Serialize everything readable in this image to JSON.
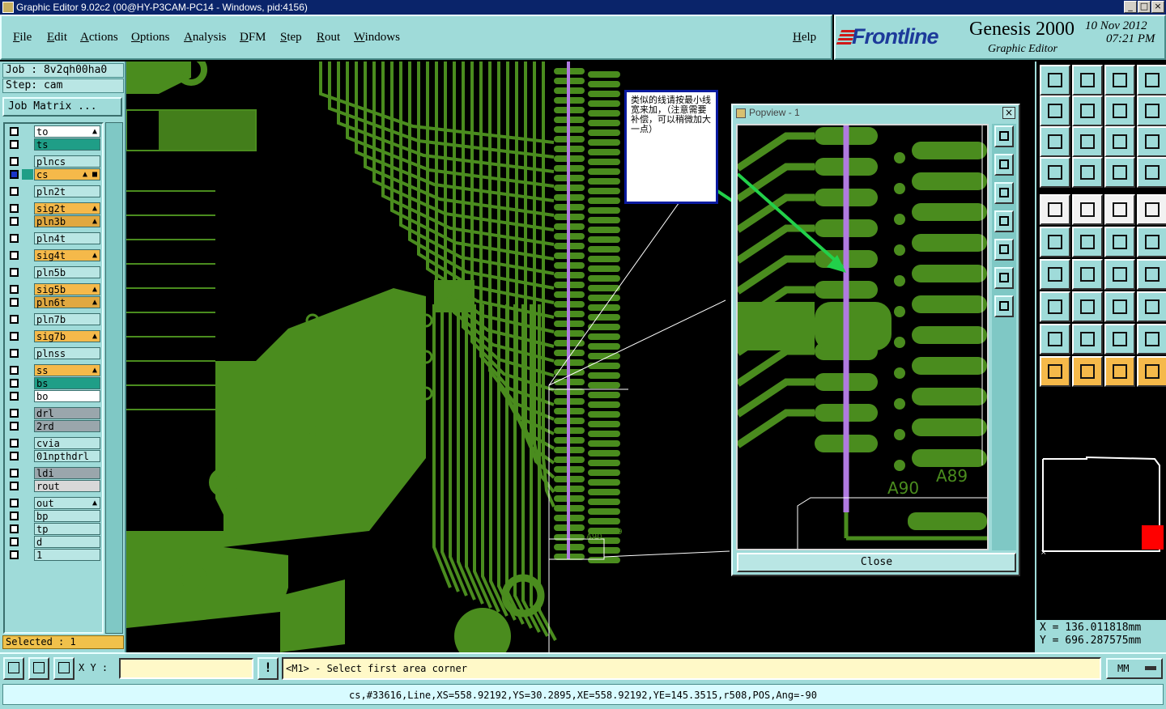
{
  "window": {
    "title": "Graphic Editor 9.02c2 (00@HY-P3CAM-PC14 - Windows, pid:4156)"
  },
  "menu": [
    "File",
    "Edit",
    "Actions",
    "Options",
    "Analysis",
    "DFM",
    "Step",
    "Rout",
    "Windows"
  ],
  "help": "Help",
  "brand": {
    "logo": "Frontline",
    "product": "Genesis 2000",
    "subtitle": "Graphic Editor",
    "date": "10 Nov 2012",
    "time": "07:21 PM"
  },
  "job": {
    "job_line": "Job : 8v2qh00ha0",
    "step_line": "Step: cam",
    "matrix_button": "Job Matrix ..."
  },
  "layers": [
    {
      "name": "to",
      "color": "#ffffff",
      "mark": "▲"
    },
    {
      "name": "ts",
      "color": "#1f9e87",
      "mark": ""
    },
    {
      "name": "plncs",
      "color": "#b9e6e4",
      "mark": ""
    },
    {
      "name": "cs",
      "color": "#f5b94a",
      "mark": "▲ ■",
      "active": true
    },
    {
      "name": "pln2t",
      "color": "#b9e6e4",
      "mark": ""
    },
    {
      "name": "sig2t",
      "color": "#f5b94a",
      "mark": "▲"
    },
    {
      "name": "pln3b",
      "color": "#e0a840",
      "mark": "▲"
    },
    {
      "name": "pln4t",
      "color": "#b9e6e4",
      "mark": ""
    },
    {
      "name": "sig4t",
      "color": "#f5b94a",
      "mark": "▲"
    },
    {
      "name": "pln5b",
      "color": "#b9e6e4",
      "mark": ""
    },
    {
      "name": "sig5b",
      "color": "#f5b94a",
      "mark": "▲"
    },
    {
      "name": "pln6t",
      "color": "#e0a840",
      "mark": "▲"
    },
    {
      "name": "pln7b",
      "color": "#b9e6e4",
      "mark": ""
    },
    {
      "name": "sig7b",
      "color": "#f5b94a",
      "mark": "▲"
    },
    {
      "name": "plnss",
      "color": "#b9e6e4",
      "mark": ""
    },
    {
      "name": "ss",
      "color": "#f5b94a",
      "mark": "▲"
    },
    {
      "name": "bs",
      "color": "#1f9e87",
      "mark": ""
    },
    {
      "name": "bo",
      "color": "#ffffff",
      "mark": ""
    },
    {
      "name": "drl",
      "color": "#9aa6ac",
      "mark": ""
    },
    {
      "name": "2rd",
      "color": "#9aa6ac",
      "mark": ""
    },
    {
      "name": "cvia",
      "color": "#b9e6e4",
      "mark": ""
    },
    {
      "name": "01npthdrl",
      "color": "#b9e6e4",
      "mark": ""
    },
    {
      "name": "ldi",
      "color": "#9aa6ac",
      "mark": ""
    },
    {
      "name": "rout",
      "color": "#d8d8d8",
      "mark": ""
    },
    {
      "name": "out",
      "color": "#b9e6e4",
      "mark": "▲"
    },
    {
      "name": "bp",
      "color": "#b9e6e4",
      "mark": ""
    },
    {
      "name": "tp",
      "color": "#b9e6e4",
      "mark": ""
    },
    {
      "name": "d",
      "color": "#b9e6e4",
      "mark": ""
    },
    {
      "name": "1",
      "color": "#b9e6e4",
      "mark": ""
    }
  ],
  "selected": "Selected : 1",
  "note": "类似的线请按最小线宽来加，（注意需要补偿，可以稍微加大一点）",
  "popview": {
    "title": "Popview - 1",
    "close": "Close",
    "label_a90": "A90",
    "label_a89": "A89"
  },
  "canvas": {
    "label_a90": "A90",
    "label_a89": "A89"
  },
  "coords": {
    "x": "X = 136.011818mm",
    "y": "Y = 696.287575mm"
  },
  "bottom": {
    "xy_label": "X Y :",
    "xy_value": "",
    "bang": "!",
    "prompt": "<M1> - Select first area corner",
    "units": "MM",
    "status": "cs,#33616,Line,XS=558.92192,YS=30.2895,XE=558.92192,YE=145.3515,r508,POS,Ang=-90"
  },
  "colors": {
    "copper": "#4a8c1e",
    "highlight": "#b07ae0",
    "arrow": "#22d04a",
    "panel": "#9fdbd9"
  }
}
